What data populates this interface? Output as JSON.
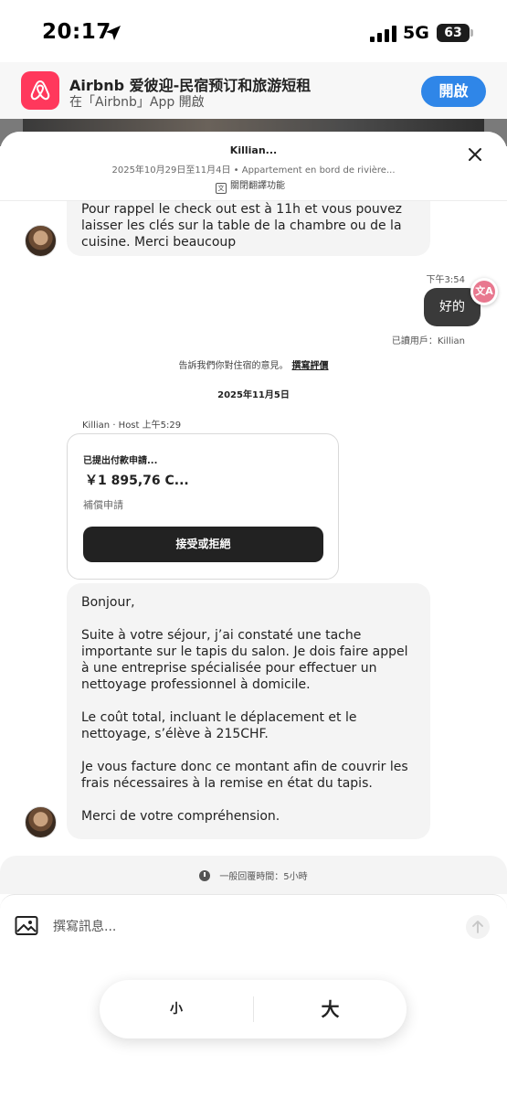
{
  "status_bar": {
    "time": "20:17",
    "network": "5G",
    "battery": "63"
  },
  "app_banner": {
    "title": "Airbnb 爱彼迎-民宿预订和旅游短租",
    "subtitle": "在「Airbnb」App 開啟",
    "open_label": "開啟",
    "brand_color": "#ff385c",
    "button_color": "#2f86e8"
  },
  "header": {
    "host_name": "Killian...",
    "trip_info": "2025年10月29日至11月4日 • Appartement en bord de rivière...",
    "translate_label": "關閉翻譯功能"
  },
  "messages": {
    "top_bubble_text": "Pour rappel le check out est à 11h et vous pouvez laisser les clés sur la table de la chambre ou de la cuisine. Merci beaucoup",
    "outgoing_time": "下午3:54",
    "outgoing_text": "好的",
    "read_receipt": "已讀用戶：Killian",
    "review_prompt": "告訴我們你對住宿的意見。",
    "review_link": "撰寫評價",
    "date_separator": "2025年11月5日",
    "sender_line": "Killian · Host  上午5:29",
    "payment_card": {
      "title": "已提出付款申請...",
      "amount": "￥1 895,76 C...",
      "type": "補償申請",
      "button_label": "接受或拒絕"
    },
    "long_bubble": {
      "p1": "Bonjour,",
      "p2": "Suite à votre séjour, j’ai constaté une tache importante sur le tapis du salon. Je dois faire appel à une entreprise spécialisée pour effectuer un nettoyage professionnel à domicile.",
      "p3": "Le coût total, incluant le déplacement et le nettoyage, s’élève à 215CHF.",
      "p4": "Je vous facture donc ce montant afin de couvrir les frais nécessaires à la remise en état du tapis.",
      "p5": "Merci de votre compréhension."
    }
  },
  "response_time": "一般回覆時間：5小時",
  "composer": {
    "placeholder": "撰寫訊息..."
  },
  "text_size": {
    "small_label": "小",
    "large_label": "大"
  }
}
